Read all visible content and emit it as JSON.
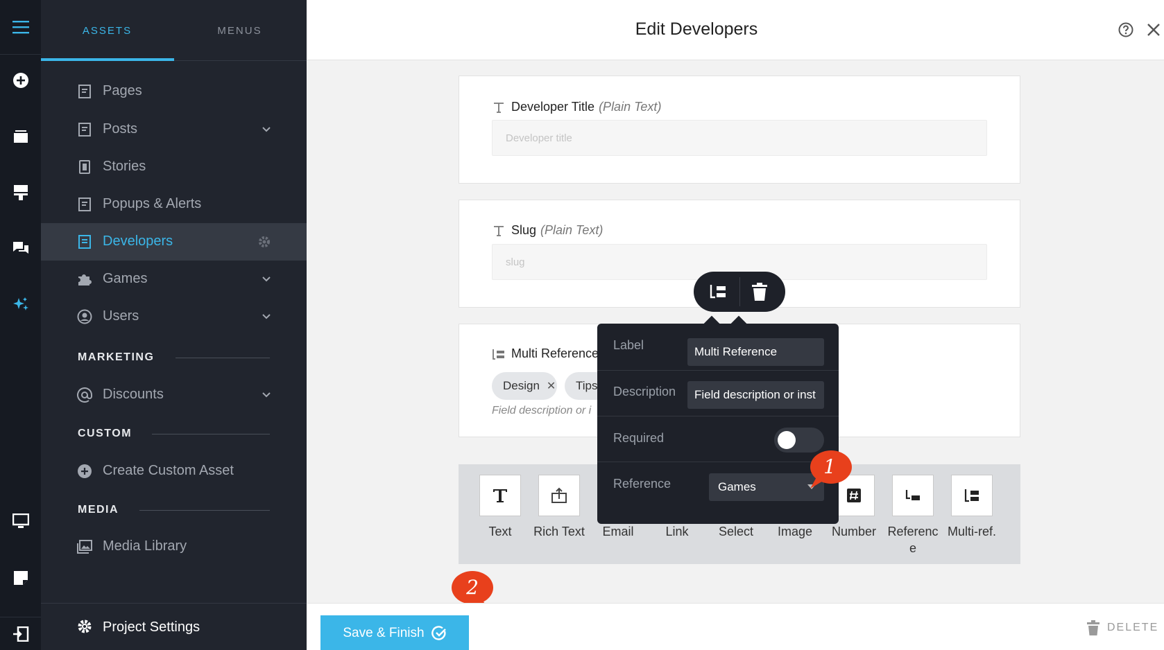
{
  "header": {
    "title": "Edit Developers"
  },
  "sidebar": {
    "tabs": [
      {
        "label": "ASSETS"
      },
      {
        "label": "MENUS"
      }
    ],
    "items": [
      {
        "label": "Pages"
      },
      {
        "label": "Posts"
      },
      {
        "label": "Stories"
      },
      {
        "label": "Popups & Alerts"
      },
      {
        "label": "Developers"
      },
      {
        "label": "Games"
      },
      {
        "label": "Users"
      }
    ],
    "sections": {
      "marketing": "MARKETING",
      "custom": "CUSTOM",
      "media": "MEDIA"
    },
    "marketing_items": [
      {
        "label": "Discounts"
      }
    ],
    "custom_items": [
      {
        "label": "Create Custom Asset"
      }
    ],
    "media_items": [
      {
        "label": "Media Library"
      }
    ],
    "project_settings": "Project Settings"
  },
  "fields": [
    {
      "label": "Developer Title",
      "kind": "(Plain Text)",
      "placeholder": "Developer title"
    },
    {
      "label": "Slug",
      "kind": "(Plain Text)",
      "placeholder": "slug"
    },
    {
      "label": "Multi Reference",
      "chips": [
        "Design",
        "Tips"
      ],
      "description": "Field description or i"
    }
  ],
  "palette": [
    {
      "name": "Text",
      "icon": "text-type-icon"
    },
    {
      "name": "Rich Text",
      "icon": "rich-text-icon"
    },
    {
      "name": "Email",
      "icon": "email-icon"
    },
    {
      "name": "Link",
      "icon": "link-icon"
    },
    {
      "name": "Select",
      "icon": "select-icon"
    },
    {
      "name": "Image",
      "icon": "image-icon"
    },
    {
      "name": "Number",
      "icon": "number-icon"
    },
    {
      "name": "Reference",
      "icon": "reference-icon"
    },
    {
      "name": "Multi-ref.",
      "icon": "multi-ref-icon"
    }
  ],
  "popover": {
    "label_label": "Label",
    "label_value": "Multi Reference",
    "description_label": "Description",
    "description_value": "Field description or inst",
    "required_label": "Required",
    "required": false,
    "reference_label": "Reference",
    "reference_value": "Games"
  },
  "callouts": [
    "1",
    "2"
  ],
  "footer": {
    "save_label": "Save & Finish",
    "delete_label": "DELETE"
  },
  "colors": {
    "accent": "#3bb6e8",
    "callout": "#e8401c",
    "rail": "#161a22",
    "sidebar": "#21252e"
  }
}
